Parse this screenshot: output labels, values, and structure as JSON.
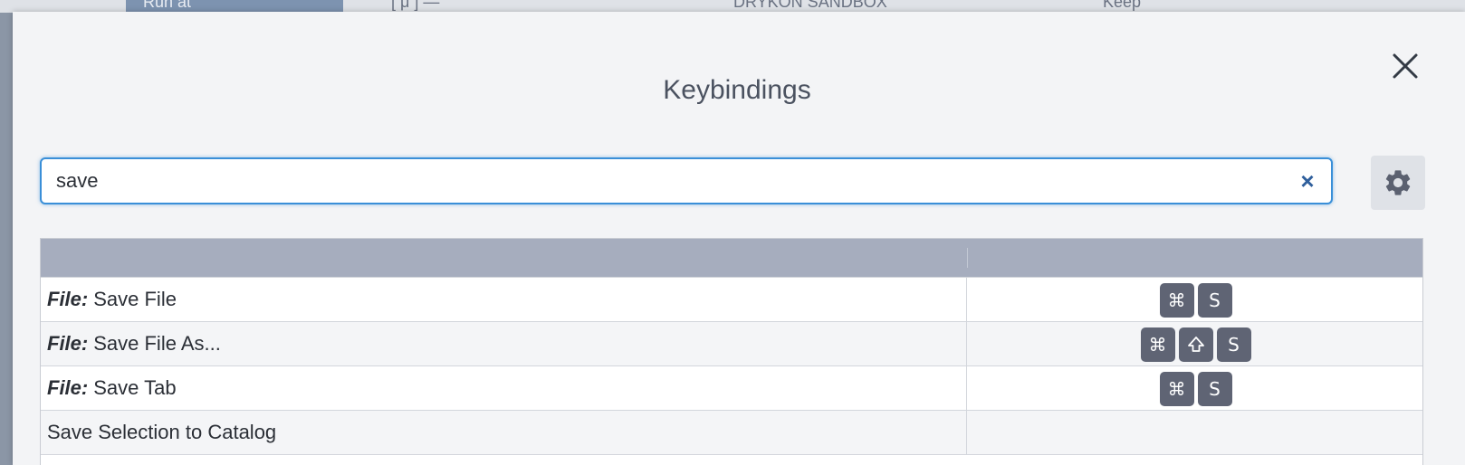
{
  "background": {
    "run_button_label": "Run at",
    "field_text": "[ μ ] —",
    "sandbox_label": "DRYKON SANDBOX",
    "keep_label": "Keep"
  },
  "modal": {
    "title": "Keybindings",
    "close_icon": "close-icon",
    "search": {
      "value": "save",
      "clear_icon": "clear-x-icon"
    },
    "settings_icon": "gear-icon",
    "table": {
      "columns": [
        "",
        ""
      ],
      "rows": [
        {
          "category": "File:",
          "command": "Save File",
          "keys": [
            "⌘",
            "S"
          ]
        },
        {
          "category": "File:",
          "command": "Save File As...",
          "keys": [
            "⌘",
            "shift-arrow-icon",
            "S"
          ]
        },
        {
          "category": "File:",
          "command": "Save Tab",
          "keys": [
            "⌘",
            "S"
          ]
        },
        {
          "category": "",
          "command": "Save Selection to Catalog",
          "keys": []
        }
      ]
    }
  },
  "colors": {
    "accent": "#3a8fd8",
    "header": "#a6adbe",
    "key_bg": "#5f6474",
    "clear_x": "#2f5f9c"
  }
}
